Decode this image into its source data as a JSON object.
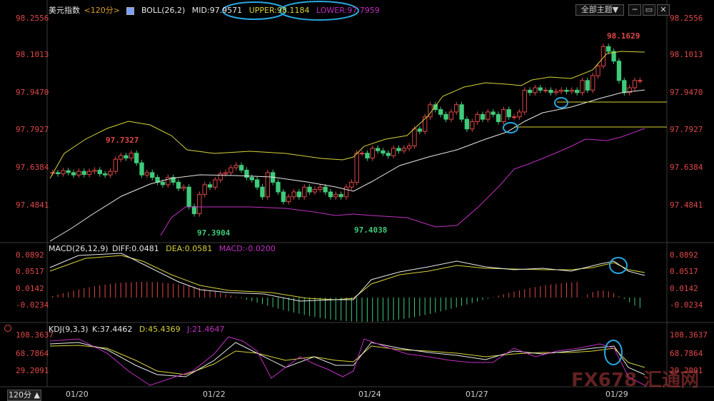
{
  "header": {
    "symbol": "美元指数",
    "period": "<120分>",
    "indicator": "BOLL(26,2)",
    "mid": "MID:97.9571",
    "upper": "UPPER:98.1184",
    "lower": "LOWER:97.7959"
  },
  "controls": {
    "theme_label": "全部主题▼",
    "btn_minimize": "─",
    "btn_restore": "▭",
    "btn_close": "✕",
    "period_select": "120分 ▲"
  },
  "price_axis": [
    "98.2556",
    "98.1013",
    "97.9470",
    "97.7927",
    "97.6384",
    "97.4841"
  ],
  "annotations": {
    "high1": "97.7327",
    "low1": "97.3904",
    "low2": "97.4038",
    "high2": "98.1629"
  },
  "macd": {
    "label": "MACD(26,12,9)",
    "diff": "DIFF:0.0481",
    "dea": "DEA:0.0581",
    "macd": "MACD:-0.0200",
    "axis": [
      "0.0892",
      "0.0517",
      "0.0142",
      "-0.0234"
    ]
  },
  "kdj": {
    "label": "KDJ(9,3,3)",
    "k": "K:37.4462",
    "d": "D:45.4369",
    "j": "J:21.4647",
    "axis": [
      "108.3637",
      "68.7864",
      "29.2091"
    ]
  },
  "dates": [
    "01/20",
    "01/22",
    "01/24",
    "01/27",
    "01/29"
  ],
  "watermark": "FX678 汇通网",
  "colors": {
    "up": "#e04848",
    "down": "#3ecb7a",
    "boll_upper": "#d8d23a",
    "boll_mid": "#e8e8e8",
    "boll_lower": "#c030c0",
    "annotation_circle": "#29a7e0"
  }
}
